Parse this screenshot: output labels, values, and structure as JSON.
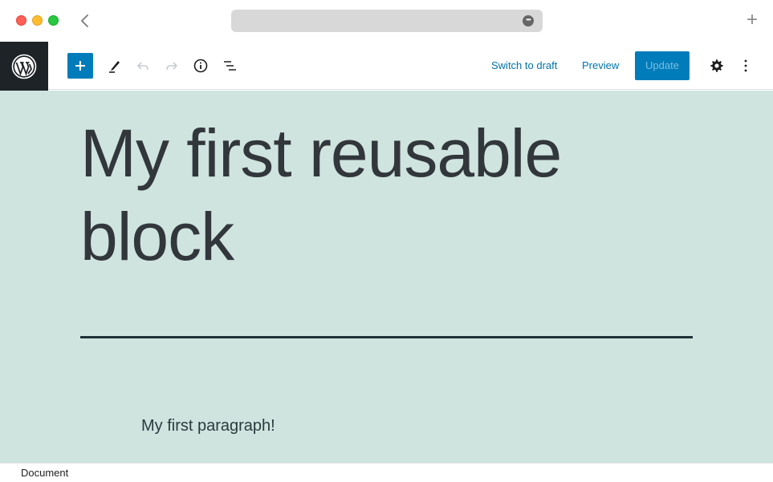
{
  "browser": {
    "back_icon": "chevron-left",
    "url_more_icon": "ellipsis-circle",
    "url_more_label": "•••",
    "new_tab_label": "+"
  },
  "toolbar": {
    "logo": "wordpress-logo",
    "add_block_label": "Add block",
    "tools_label": "Tools",
    "undo_label": "Undo",
    "redo_label": "Redo",
    "details_label": "Details",
    "list_view_label": "List view",
    "switch_to_draft": "Switch to draft",
    "preview": "Preview",
    "update": "Update",
    "settings_label": "Settings",
    "options_label": "Options"
  },
  "colors": {
    "accent": "#007cba",
    "canvas_background": "#cfe4de",
    "title_text": "#32373c",
    "separator": "#1e3338",
    "logo_background": "#1e2327"
  },
  "content": {
    "title": "My first reusable block",
    "paragraph": "My first paragraph!"
  },
  "footer": {
    "breadcrumb": "Document"
  }
}
